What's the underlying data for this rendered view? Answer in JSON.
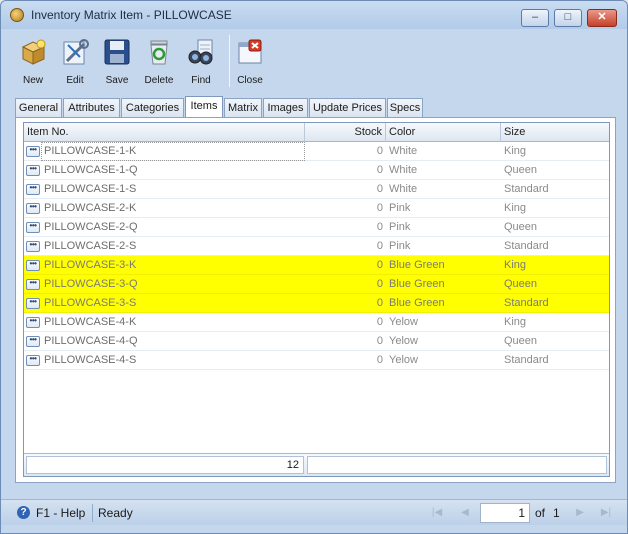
{
  "window": {
    "title": "Inventory Matrix Item - PILLOWCASE",
    "minimize": "–",
    "maximize": "□",
    "close": "✕"
  },
  "toolbar": {
    "new_label": "New",
    "edit_label": "Edit",
    "save_label": "Save",
    "delete_label": "Delete",
    "find_label": "Find",
    "close_label": "Close"
  },
  "tabs": [
    {
      "label": "General"
    },
    {
      "label": "Attributes"
    },
    {
      "label": "Categories"
    },
    {
      "label": "Items"
    },
    {
      "label": "Matrix"
    },
    {
      "label": "Images"
    },
    {
      "label": "Update Prices"
    },
    {
      "label": "Specs"
    }
  ],
  "active_tab": "Items",
  "grid": {
    "columns": {
      "item": "Item No.",
      "stock": "Stock",
      "color": "Color",
      "size": "Size"
    },
    "rows": [
      {
        "item": "PILLOWCASE-1-K",
        "stock": "0",
        "color": "White",
        "size": "King"
      },
      {
        "item": "PILLOWCASE-1-Q",
        "stock": "0",
        "color": "White",
        "size": "Queen"
      },
      {
        "item": "PILLOWCASE-1-S",
        "stock": "0",
        "color": "White",
        "size": "Standard"
      },
      {
        "item": "PILLOWCASE-2-K",
        "stock": "0",
        "color": "Pink",
        "size": "King"
      },
      {
        "item": "PILLOWCASE-2-Q",
        "stock": "0",
        "color": "Pink",
        "size": "Queen"
      },
      {
        "item": "PILLOWCASE-2-S",
        "stock": "0",
        "color": "Pink",
        "size": "Standard"
      },
      {
        "item": "PILLOWCASE-3-K",
        "stock": "0",
        "color": "Blue Green",
        "size": "King"
      },
      {
        "item": "PILLOWCASE-3-Q",
        "stock": "0",
        "color": "Blue Green",
        "size": "Queen"
      },
      {
        "item": "PILLOWCASE-3-S",
        "stock": "0",
        "color": "Blue Green",
        "size": "Standard"
      },
      {
        "item": "PILLOWCASE-4-K",
        "stock": "0",
        "color": "Yelow",
        "size": "King"
      },
      {
        "item": "PILLOWCASE-4-Q",
        "stock": "0",
        "color": "Yelow",
        "size": "Queen"
      },
      {
        "item": "PILLOWCASE-4-S",
        "stock": "0",
        "color": "Yelow",
        "size": "Standard"
      }
    ],
    "highlight_color": "#ffff00",
    "footer_count": "12"
  },
  "status": {
    "help": "F1 - Help",
    "state": "Ready",
    "page": "1",
    "of_label": "of",
    "total_pages": "1"
  }
}
